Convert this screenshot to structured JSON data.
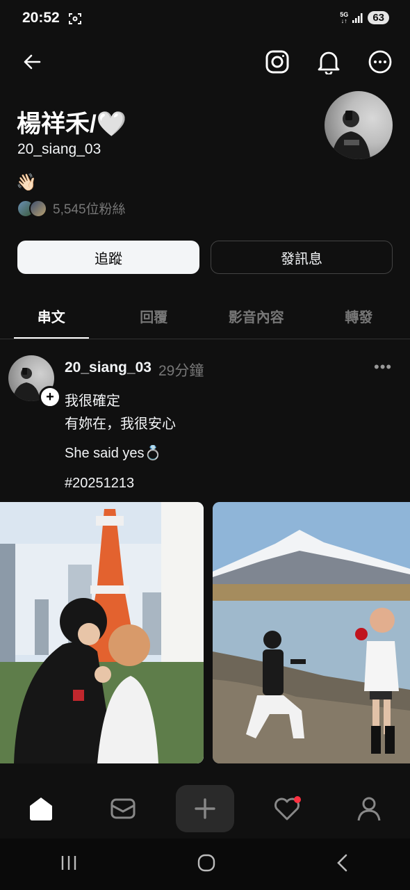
{
  "status_bar": {
    "time": "20:52",
    "network": "5G",
    "battery": "63"
  },
  "header": {
    "icons": [
      "back-arrow-icon",
      "instagram-icon",
      "bell-icon",
      "more-options-icon"
    ]
  },
  "profile": {
    "display_name": "楊祥禾/🤍",
    "username": "20_siang_03",
    "bio_emoji": "👋🏻",
    "followers_text": "5,545位粉絲"
  },
  "actions": {
    "follow": "追蹤",
    "message": "發訊息"
  },
  "tabs": [
    {
      "label": "串文",
      "active": true
    },
    {
      "label": "回覆",
      "active": false
    },
    {
      "label": "影音內容",
      "active": false
    },
    {
      "label": "轉發",
      "active": false
    }
  ],
  "post": {
    "username": "20_siang_03",
    "time": "29分鐘",
    "lines": [
      "我很確定",
      "有妳在，我很安心",
      "She said yes💍",
      "#20251213"
    ]
  },
  "bottom_nav": {
    "icons": [
      "home-icon",
      "inbox-icon",
      "create-icon",
      "activity-heart-icon",
      "profile-icon"
    ]
  },
  "colors": {
    "background": "#101010",
    "text": "#f3f5f7",
    "muted": "#777777",
    "notification_dot": "#ff3040"
  }
}
